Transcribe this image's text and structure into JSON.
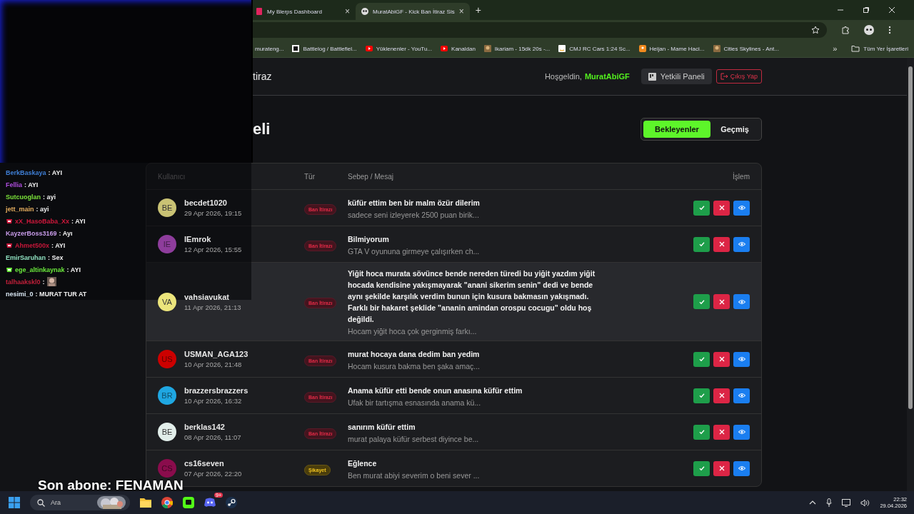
{
  "browser": {
    "tabs": [
      {
        "title": "My Blerps Dashboard",
        "close": "×",
        "selected": false
      },
      {
        "title": "MuratAbiGF - Kick Ban İtiraz Sis",
        "close": "×",
        "selected": true
      }
    ],
    "new_tab": "+",
    "bookmarks": [
      {
        "label": "murateng...",
        "kind": "plain"
      },
      {
        "label": "Battlelog / Battlefiel...",
        "kind": "bl"
      },
      {
        "label": "Yüklenenler - YouTu...",
        "kind": "yt"
      },
      {
        "label": "Kanaldan",
        "kind": "yt"
      },
      {
        "label": "Ikariam - 15dk 20s -...",
        "kind": "game"
      },
      {
        "label": "CMJ RC Cars 1:24 Sc...",
        "kind": "amazon"
      },
      {
        "label": "Heijan - Mame Haci...",
        "kind": "orange"
      },
      {
        "label": "Cities Skylines - Ant...",
        "kind": "game"
      }
    ],
    "bookmarks_more": "»",
    "all_bookmarks": "Tüm Yer İşaretleri"
  },
  "header": {
    "title": "tiraz",
    "greeting": "Hoşgeldin,",
    "username": "MuratAbiGF",
    "panel_button": "Yetkili Paneli",
    "logout_button": "Çıkış Yap"
  },
  "page_heading": "eli",
  "filter_tabs": [
    {
      "label": "Bekleyenler",
      "selected": true
    },
    {
      "label": "Geçmiş",
      "selected": false
    }
  ],
  "table": {
    "columns": [
      "Kullanıcı",
      "Tür",
      "Sebep / Mesaj",
      "İşlem"
    ],
    "rows": [
      {
        "initials": "BE",
        "color": "#c9c274",
        "user": "becdet1020",
        "date": "29 Apr 2026, 19:15",
        "type": "Ban İtirazı",
        "kind": "ban",
        "title": "küfür ettim ben bir malm özür dilerim",
        "message": "sadece seni izleyerek 2500 puan birik...",
        "highlighted": false
      },
      {
        "initials": "IE",
        "color": "#8e3d9c",
        "user": "lEmrok",
        "date": "12 Apr 2026, 15:55",
        "type": "Ban İtirazı",
        "kind": "ban",
        "title": "Bilmiyorum",
        "message": "GTA V oyununa girmeye çalışırken ch...",
        "highlighted": false
      },
      {
        "initials": "VA",
        "color": "#ece57c",
        "user": "vahsiavukat",
        "date": "11 Apr 2026, 21:13",
        "type": "Ban İtirazı",
        "kind": "ban",
        "title": "Yiğit hoca murata sövünce bende nereden türedi bu yiğit yazdım yiğit hocada kendisine yakışmayarak \"anani sikerim senin\" dedi ve bende aynı şekilde karşılık verdim bunun için kusura bakmasın yakışmadı. Farklı bir hakaret şeklide \"ananin amindan orospu cocugu\" oldu hoş değildi.",
        "message": "Hocam yiğit hoca çok gerginmiş farkı...",
        "highlighted": true
      },
      {
        "initials": "US",
        "color": "#cc0000",
        "user": "USMAN_AGA123",
        "date": "10 Apr 2026, 21:48",
        "type": "Ban İtirazı",
        "kind": "ban",
        "title": "murat hocaya dana dedim ban yedim",
        "message": "Hocam kusura bakma ben şaka amaç...",
        "highlighted": false
      },
      {
        "initials": "BR",
        "color": "#1fa7e2",
        "user": "brazzersbrazzers",
        "date": "10 Apr 2026, 16:32",
        "type": "Ban İtirazı",
        "kind": "ban",
        "title": "Anama küfür etti bende onun anasına küfür ettim",
        "message": "Ufak bir tartışma esnasında anama kü...",
        "highlighted": false
      },
      {
        "initials": "BE",
        "color": "#e2eeea",
        "user": "berklas142",
        "date": "08 Apr 2026, 11:07",
        "type": "Ban İtirazı",
        "kind": "ban",
        "title": "sanırım küfür ettim",
        "message": "murat palaya küfür serbest diyince be...",
        "highlighted": false
      },
      {
        "initials": "CS",
        "color": "#8a0c4c",
        "user": "cs16seven",
        "date": "07 Apr 2026, 22:20",
        "type": "Şikayet",
        "kind": "complaint",
        "title": "Eğlence",
        "message": "Ben murat abiyi severim o beni sever ...",
        "highlighted": false
      }
    ]
  },
  "chat": [
    {
      "user": "BerkBaskaya",
      "text": ": AYI",
      "color": "#3f7fd6",
      "badge": false,
      "emote": false
    },
    {
      "user": "Fellia",
      "text": ": AYI",
      "color": "#b04fe0",
      "badge": false,
      "emote": false
    },
    {
      "user": "Sutcuoglan",
      "text": ": ayi",
      "color": "#7be33a",
      "badge": false,
      "emote": false
    },
    {
      "user": "jett_main",
      "text": ": ayi",
      "color": "#e8b060",
      "badge": false,
      "emote": false
    },
    {
      "user": "xX_HasoBaba_Xx",
      "text": ": AYI",
      "color": "#d0183c",
      "badge": true,
      "emote": false
    },
    {
      "user": "KayzerBoss3169",
      "text": ": Ayı",
      "color": "#c79be8",
      "badge": false,
      "emote": false
    },
    {
      "user": "Ahmet500x",
      "text": ": AYI",
      "color": "#c8173a",
      "badge": true,
      "emote": false
    },
    {
      "user": "EmirSaruhan",
      "text": ": Sex",
      "color": "#8fe0c0",
      "badge": false,
      "emote": false
    },
    {
      "user": "ege_altinkaynak",
      "text": ": AYI",
      "color": "#6bea3c",
      "badge": true,
      "emote": false
    },
    {
      "user": "talhaakskl0",
      "text": ":",
      "color": "#c0203a",
      "badge": false,
      "emote": true
    },
    {
      "user": "nesimi_0",
      "text": ": MURAT TUR AT",
      "color": "#d8e6f2",
      "badge": false,
      "emote": false
    }
  ],
  "subscriber": "Son abone: FENAMAN",
  "taskbar": {
    "search": "Ara",
    "discord_badge": "9+",
    "time": "22:32",
    "date": "29.04.2026"
  }
}
